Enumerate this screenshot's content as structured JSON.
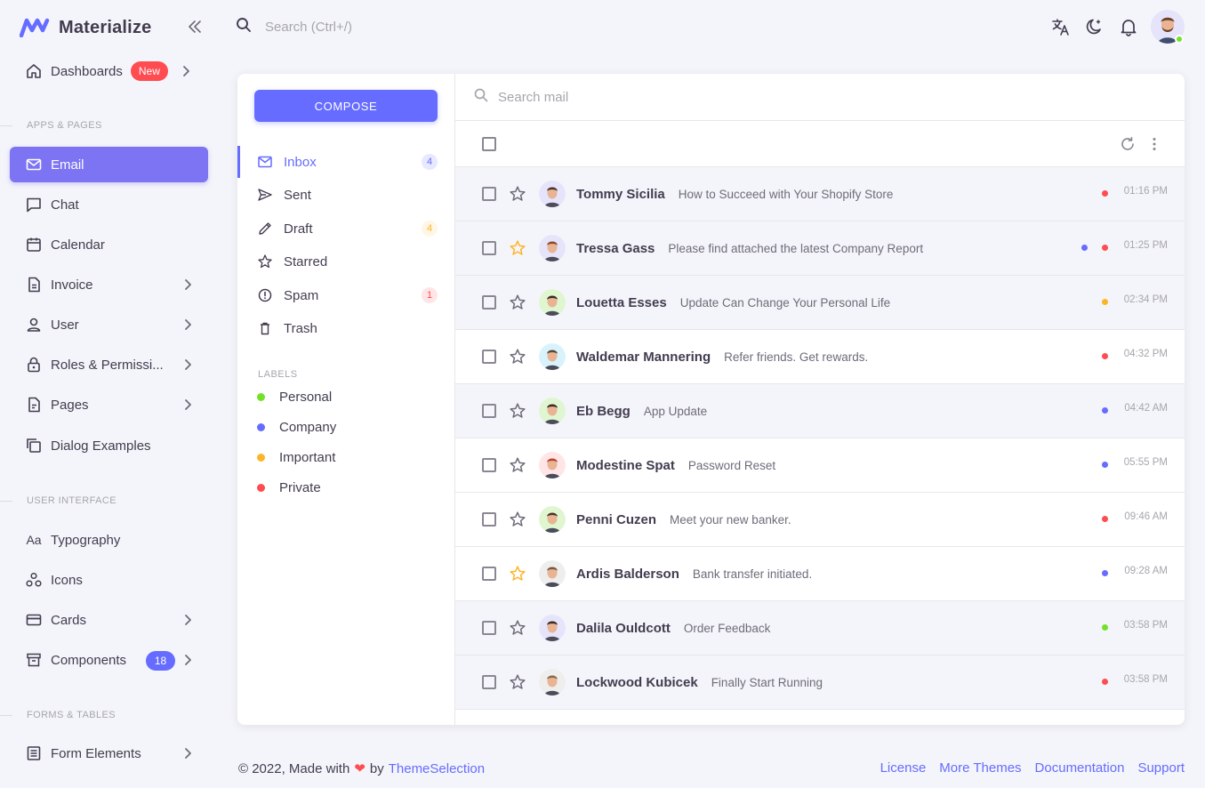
{
  "brand": {
    "name": "Materialize"
  },
  "colors": {
    "primary": "#666cff",
    "danger": "#ff4c51",
    "success": "#72e128",
    "warning": "#fdb528",
    "info": "#26c6f9"
  },
  "top_search": {
    "placeholder": "Search (Ctrl+/)"
  },
  "top_icons": [
    "translate-icon",
    "moon-icon",
    "bell-icon"
  ],
  "sidebar": {
    "dashboards": {
      "label": "Dashboards",
      "badge": "New"
    },
    "sections": {
      "apps": "APPS & PAGES",
      "ui": "USER INTERFACE",
      "forms": "FORMS & TABLES"
    },
    "items": [
      {
        "label": "Email",
        "icon": "mail-icon"
      },
      {
        "label": "Chat",
        "icon": "chat-icon"
      },
      {
        "label": "Calendar",
        "icon": "calendar-icon"
      },
      {
        "label": "Invoice",
        "icon": "invoice-icon"
      },
      {
        "label": "User",
        "icon": "user-icon"
      },
      {
        "label": "Roles & Permissi...",
        "icon": "lock-icon"
      },
      {
        "label": "Pages",
        "icon": "pages-icon"
      },
      {
        "label": "Dialog Examples",
        "icon": "dialog-icon"
      },
      {
        "label": "Typography",
        "icon": "typography-icon"
      },
      {
        "label": "Icons",
        "icon": "icons-icon"
      },
      {
        "label": "Cards",
        "icon": "card-icon"
      },
      {
        "label": "Components",
        "icon": "components-icon",
        "badge": "18"
      },
      {
        "label": "Form Elements",
        "icon": "form-icon"
      }
    ]
  },
  "mail_nav": {
    "compose": "COMPOSE",
    "folders": [
      {
        "label": "Inbox",
        "count": "4"
      },
      {
        "label": "Sent"
      },
      {
        "label": "Draft",
        "count": "4"
      },
      {
        "label": "Starred"
      },
      {
        "label": "Spam",
        "count": "1"
      },
      {
        "label": "Trash"
      }
    ],
    "labels_head": "LABELS",
    "labels": [
      {
        "label": "Personal",
        "color": "#72e128"
      },
      {
        "label": "Company",
        "color": "#666cff"
      },
      {
        "label": "Important",
        "color": "#fdb528"
      },
      {
        "label": "Private",
        "color": "#ff4c51"
      }
    ]
  },
  "mail_search": {
    "placeholder": "Search mail"
  },
  "emails": [
    {
      "sender": "Tommy Sicilia",
      "subject": "How to Succeed with Your Shopify Store",
      "time": "01:16 PM",
      "starred": false,
      "read": true,
      "labels": [
        "#ff4c51"
      ]
    },
    {
      "sender": "Tressa Gass",
      "subject": "Please find attached the latest Company Report",
      "time": "01:25 PM",
      "starred": true,
      "read": true,
      "labels": [
        "#666cff",
        "#ff4c51"
      ]
    },
    {
      "sender": "Louetta Esses",
      "subject": "Update Can Change Your Personal Life",
      "time": "02:34 PM",
      "starred": false,
      "read": true,
      "labels": [
        "#fdb528"
      ]
    },
    {
      "sender": "Waldemar Mannering",
      "subject": "Refer friends. Get rewards.",
      "time": "04:32 PM",
      "starred": false,
      "read": false,
      "labels": [
        "#ff4c51"
      ]
    },
    {
      "sender": "Eb Begg",
      "subject": "App Update",
      "time": "04:42 AM",
      "starred": false,
      "read": true,
      "labels": [
        "#666cff"
      ]
    },
    {
      "sender": "Modestine Spat",
      "subject": "Password Reset",
      "time": "05:55 PM",
      "starred": false,
      "read": false,
      "labels": [
        "#666cff"
      ]
    },
    {
      "sender": "Penni Cuzen",
      "subject": "Meet your new banker.",
      "time": "09:46 AM",
      "starred": false,
      "read": false,
      "labels": [
        "#ff4c51"
      ]
    },
    {
      "sender": "Ardis Balderson",
      "subject": "Bank transfer initiated.",
      "time": "09:28 AM",
      "starred": true,
      "read": false,
      "labels": [
        "#666cff"
      ]
    },
    {
      "sender": "Dalila Ouldcott",
      "subject": "Order Feedback",
      "time": "03:58 PM",
      "starred": false,
      "read": true,
      "labels": [
        "#72e128"
      ]
    },
    {
      "sender": "Lockwood Kubicek",
      "subject": "Finally Start Running",
      "time": "03:58 PM",
      "starred": false,
      "read": true,
      "labels": [
        "#ff4c51"
      ]
    }
  ],
  "footer": {
    "copyright": "© 2022, Made with",
    "by": "by",
    "brand_link": "ThemeSelection",
    "links": [
      "License",
      "More Themes",
      "Documentation",
      "Support"
    ]
  }
}
